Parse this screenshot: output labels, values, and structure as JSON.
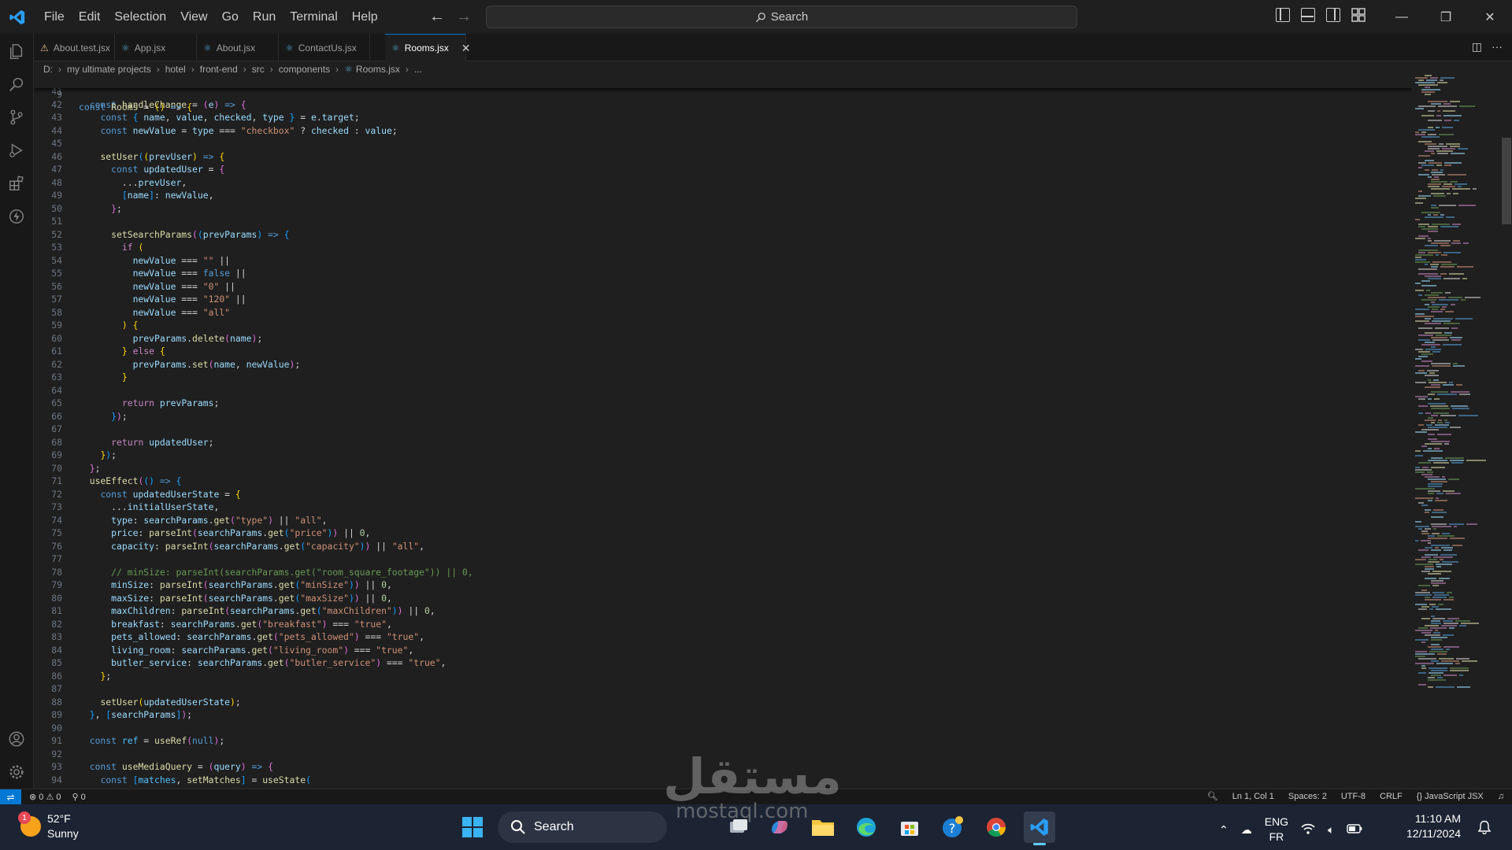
{
  "menu": [
    "File",
    "Edit",
    "Selection",
    "View",
    "Go",
    "Run",
    "Terminal",
    "Help"
  ],
  "search": {
    "label": "Search"
  },
  "tabs": [
    {
      "label": "About.test.jsx",
      "icon": "warning-js-icon",
      "active": false
    },
    {
      "label": "App.jsx",
      "icon": "react-icon",
      "active": false
    },
    {
      "label": "About.jsx",
      "icon": "react-icon",
      "active": false
    },
    {
      "label": "ContactUs.jsx",
      "icon": "react-icon",
      "active": false
    },
    {
      "label": "Rooms.jsx",
      "icon": "react-icon",
      "active": true
    }
  ],
  "breadcrumb": [
    "D:",
    "my ultimate projects",
    "hotel",
    "front-end",
    "src",
    "components",
    "Rooms.jsx",
    "..."
  ],
  "sticky_line": {
    "num": "9",
    "text": "const Rooms = () => {"
  },
  "code_lines": [
    {
      "num": "41",
      "html": ""
    },
    {
      "num": "42",
      "html": "  <span class='kw'>const</span> <span class='fn'>handleChange</span> = <span class='b2'>(</span><span class='var'>e</span><span class='b2'>)</span> <span class='kw'>=&gt;</span> <span class='b2'>{</span>"
    },
    {
      "num": "43",
      "html": "    <span class='kw'>const</span> <span class='b3'>{</span> <span class='var'>name</span>, <span class='var'>value</span>, <span class='var'>checked</span>, <span class='var'>type</span> <span class='b3'>}</span> = <span class='var'>e</span>.<span class='var'>target</span>;"
    },
    {
      "num": "44",
      "html": "    <span class='kw'>const</span> <span class='var'>newValue</span> = <span class='var'>type</span> === <span class='str'>\"checkbox\"</span> ? <span class='var'>checked</span> : <span class='var'>value</span>;"
    },
    {
      "num": "45",
      "html": ""
    },
    {
      "num": "46",
      "html": "    <span class='fn'>setUser</span><span class='b3'>(</span><span class='b1'>(</span><span class='var'>prevUser</span><span class='b1'>)</span> <span class='kw'>=&gt;</span> <span class='b1'>{</span>"
    },
    {
      "num": "47",
      "html": "      <span class='kw'>const</span> <span class='var'>updatedUser</span> = <span class='b2'>{</span>"
    },
    {
      "num": "48",
      "html": "        ...<span class='var'>prevUser</span>,"
    },
    {
      "num": "49",
      "html": "        <span class='b3'>[</span><span class='var'>name</span><span class='b3'>]</span>: <span class='var'>newValue</span>,"
    },
    {
      "num": "50",
      "html": "      <span class='b2'>}</span>;"
    },
    {
      "num": "51",
      "html": ""
    },
    {
      "num": "52",
      "html": "      <span class='fn'>setSearchParams</span><span class='b2'>(</span><span class='b3'>(</span><span class='var'>prevParams</span><span class='b3'>)</span> <span class='kw'>=&gt;</span> <span class='b3'>{</span>"
    },
    {
      "num": "53",
      "html": "        <span class='ctl'>if</span> <span class='b1'>(</span>"
    },
    {
      "num": "54",
      "html": "          <span class='var'>newValue</span> === <span class='str'>\"\"</span> ||"
    },
    {
      "num": "55",
      "html": "          <span class='var'>newValue</span> === <span class='kw'>false</span> ||"
    },
    {
      "num": "56",
      "html": "          <span class='var'>newValue</span> === <span class='str'>\"0\"</span> ||"
    },
    {
      "num": "57",
      "html": "          <span class='var'>newValue</span> === <span class='str'>\"120\"</span> ||"
    },
    {
      "num": "58",
      "html": "          <span class='var'>newValue</span> === <span class='str'>\"all\"</span>"
    },
    {
      "num": "59",
      "html": "        <span class='b1'>)</span> <span class='b1'>{</span>"
    },
    {
      "num": "60",
      "html": "          <span class='var'>prevParams</span>.<span class='fn'>delete</span><span class='b2'>(</span><span class='var'>name</span><span class='b2'>)</span>;"
    },
    {
      "num": "61",
      "html": "        <span class='b1'>}</span> <span class='ctl'>else</span> <span class='b1'>{</span>"
    },
    {
      "num": "62",
      "html": "          <span class='var'>prevParams</span>.<span class='fn'>set</span><span class='b2'>(</span><span class='var'>name</span>, <span class='var'>newValue</span><span class='b2'>)</span>;"
    },
    {
      "num": "63",
      "html": "        <span class='b1'>}</span>"
    },
    {
      "num": "64",
      "html": ""
    },
    {
      "num": "65",
      "html": "        <span class='ctl'>return</span> <span class='var'>prevParams</span>;"
    },
    {
      "num": "66",
      "html": "      <span class='b3'>}</span><span class='b2'>)</span>;"
    },
    {
      "num": "67",
      "html": ""
    },
    {
      "num": "68",
      "html": "      <span class='ctl'>return</span> <span class='var'>updatedUser</span>;"
    },
    {
      "num": "69",
      "html": "    <span class='b1'>}</span><span class='b3'>)</span>;"
    },
    {
      "num": "70",
      "html": "  <span class='b2'>}</span>;"
    },
    {
      "num": "71",
      "html": "  <span class='fn'>useEffect</span><span class='b2'>(</span><span class='b3'>()</span> <span class='kw'>=&gt;</span> <span class='b3'>{</span>"
    },
    {
      "num": "72",
      "html": "    <span class='kw'>const</span> <span class='var'>updatedUserState</span> = <span class='b1'>{</span>"
    },
    {
      "num": "73",
      "html": "      ...<span class='var'>initialUserState</span>,"
    },
    {
      "num": "74",
      "html": "      <span class='var'>type</span>: <span class='var'>searchParams</span>.<span class='fn'>get</span><span class='b2'>(</span><span class='str'>\"type\"</span><span class='b2'>)</span> || <span class='str'>\"all\"</span>,"
    },
    {
      "num": "75",
      "html": "      <span class='var'>price</span>: <span class='fn'>parseInt</span><span class='b2'>(</span><span class='var'>searchParams</span>.<span class='fn'>get</span><span class='b3'>(</span><span class='str'>\"price\"</span><span class='b3'>)</span><span class='b2'>)</span> || <span class='num'>0</span>,"
    },
    {
      "num": "76",
      "html": "      <span class='var'>capacity</span>: <span class='fn'>parseInt</span><span class='b2'>(</span><span class='var'>searchParams</span>.<span class='fn'>get</span><span class='b3'>(</span><span class='str'>\"capacity\"</span><span class='b3'>)</span><span class='b2'>)</span> || <span class='str'>\"all\"</span>,"
    },
    {
      "num": "77",
      "html": ""
    },
    {
      "num": "78",
      "html": "      <span class='cmt'>// minSize: parseInt(searchParams.get(\"room_square_footage\")) || 0,</span>"
    },
    {
      "num": "79",
      "html": "      <span class='var'>minSize</span>: <span class='fn'>parseInt</span><span class='b2'>(</span><span class='var'>searchParams</span>.<span class='fn'>get</span><span class='b3'>(</span><span class='str'>\"minSize\"</span><span class='b3'>)</span><span class='b2'>)</span> || <span class='num'>0</span>,"
    },
    {
      "num": "80",
      "html": "      <span class='var'>maxSize</span>: <span class='fn'>parseInt</span><span class='b2'>(</span><span class='var'>searchParams</span>.<span class='fn'>get</span><span class='b3'>(</span><span class='str'>\"maxSize\"</span><span class='b3'>)</span><span class='b2'>)</span> || <span class='num'>0</span>,"
    },
    {
      "num": "81",
      "html": "      <span class='var'>maxChildren</span>: <span class='fn'>parseInt</span><span class='b2'>(</span><span class='var'>searchParams</span>.<span class='fn'>get</span><span class='b3'>(</span><span class='str'>\"maxChildren\"</span><span class='b3'>)</span><span class='b2'>)</span> || <span class='num'>0</span>,"
    },
    {
      "num": "82",
      "html": "      <span class='var'>breakfast</span>: <span class='var'>searchParams</span>.<span class='fn'>get</span><span class='b2'>(</span><span class='str'>\"breakfast\"</span><span class='b2'>)</span> === <span class='str'>\"true\"</span>,"
    },
    {
      "num": "83",
      "html": "      <span class='var'>pets_allowed</span>: <span class='var'>searchParams</span>.<span class='fn'>get</span><span class='b2'>(</span><span class='str'>\"pets_allowed\"</span><span class='b2'>)</span> === <span class='str'>\"true\"</span>,"
    },
    {
      "num": "84",
      "html": "      <span class='var'>living_room</span>: <span class='var'>searchParams</span>.<span class='fn'>get</span><span class='b2'>(</span><span class='str'>\"living_room\"</span><span class='b2'>)</span> === <span class='str'>\"true\"</span>,"
    },
    {
      "num": "85",
      "html": "      <span class='var'>butler_service</span>: <span class='var'>searchParams</span>.<span class='fn'>get</span><span class='b2'>(</span><span class='str'>\"butler_service\"</span><span class='b2'>)</span> === <span class='str'>\"true\"</span>,"
    },
    {
      "num": "86",
      "html": "    <span class='b1'>}</span>;"
    },
    {
      "num": "87",
      "html": ""
    },
    {
      "num": "88",
      "html": "    <span class='fn'>setUser</span><span class='b1'>(</span><span class='var'>updatedUserState</span><span class='b1'>)</span>;"
    },
    {
      "num": "89",
      "html": "  <span class='b3'>}</span>, <span class='b3'>[</span><span class='var'>searchParams</span><span class='b3'>]</span><span class='b2'>)</span>;"
    },
    {
      "num": "90",
      "html": ""
    },
    {
      "num": "91",
      "html": "  <span class='kw'>const</span> <span class='cst'>ref</span> = <span class='fn'>useRef</span><span class='b2'>(</span><span class='kw'>null</span><span class='b2'>)</span>;"
    },
    {
      "num": "92",
      "html": ""
    },
    {
      "num": "93",
      "html": "  <span class='kw'>const</span> <span class='fn'>useMediaQuery</span> = <span class='b2'>(</span><span class='var'>query</span><span class='b2'>)</span> <span class='kw'>=&gt;</span> <span class='b2'>{</span>"
    },
    {
      "num": "94",
      "html": "    <span class='kw'>const</span> <span class='b3'>[</span><span class='cst'>matches</span>, <span class='fn'>setMatches</span><span class='b3'>]</span> = <span class='fn'>useState</span><span class='b3'>(</span>"
    }
  ],
  "status": {
    "errors": "0",
    "warnings": "0",
    "ports": "0",
    "cursor": "Ln 1, Col 1",
    "spaces": "Spaces: 2",
    "encoding": "UTF-8",
    "eol": "CRLF",
    "language": "JavaScript JSX"
  },
  "taskbar": {
    "weather_temp": "52°F",
    "weather_desc": "Sunny",
    "weather_badge": "1",
    "search_label": "Search",
    "lang_top": "ENG",
    "lang_bottom": "FR",
    "time": "11:10 AM",
    "date": "12/11/2024"
  },
  "watermark": {
    "arabic": "مستقل",
    "latin": "mostaql.com"
  },
  "colors": {
    "accent": "#0078d4",
    "editor_bg": "#1f1f1f",
    "taskbar_bg": "#1c2433"
  }
}
